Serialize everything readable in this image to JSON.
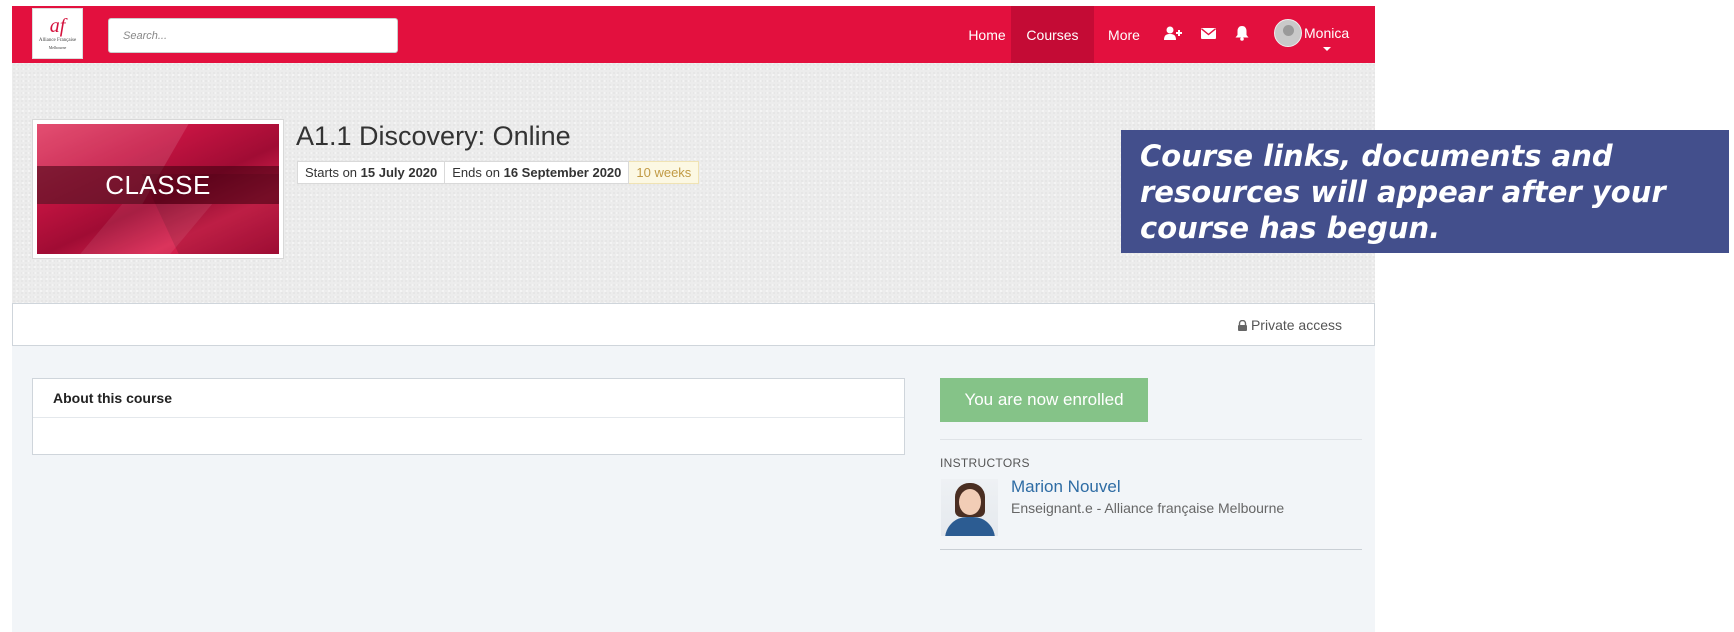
{
  "logo": {
    "mark": "af",
    "name": "Alliance Française",
    "city": "Melbourne"
  },
  "search": {
    "placeholder": "Search..."
  },
  "nav": {
    "home": "Home",
    "courses": "Courses",
    "more": "More"
  },
  "icons": {
    "add_user": "add-user-icon",
    "mail": "envelope-icon",
    "bell": "bell-icon",
    "lock": "lock-icon"
  },
  "user": {
    "name": "Monica"
  },
  "course": {
    "thumbnail_label": "CLASSE",
    "title": "A1.1 Discovery: Online",
    "starts_prefix": "Starts on ",
    "starts_date": "15 July 2020",
    "ends_prefix": "Ends on ",
    "ends_date": "16 September 2020",
    "duration": "10 weeks"
  },
  "access": {
    "label": "Private access"
  },
  "about": {
    "heading": "About this course"
  },
  "enrollment": {
    "status": "You are now enrolled"
  },
  "instructors": {
    "label": "INSTRUCTORS",
    "items": [
      {
        "name": "Marion Nouvel",
        "role": "Enseignant.e - Alliance française Melbourne"
      }
    ]
  },
  "overlay": {
    "message": "Course links, documents and resources will appear after your course has begun."
  },
  "colors": {
    "brand": "#e3103e",
    "brand_active": "#c40b35",
    "enrolled": "#85c388",
    "callout": "#434f8c",
    "link": "#2e6ca4"
  }
}
